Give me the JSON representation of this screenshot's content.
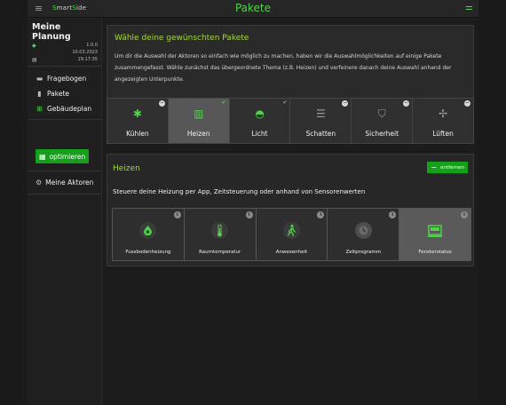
{
  "topbar": {
    "brand_prefix": "S",
    "brand_mid": "mart",
    "brand_s": "S",
    "brand_suffix": "ide",
    "title": "Pakete"
  },
  "plan": {
    "name": "Meine Planung",
    "version": "1.0.0",
    "date": "10.03.2023",
    "time": "19:17:35"
  },
  "nav": {
    "items": [
      {
        "label": "Fragebogen",
        "icon": "questionnaire-icon"
      },
      {
        "label": "Pakete",
        "icon": "package-icon"
      },
      {
        "label": "Gebäudeplan",
        "icon": "floorplan-icon"
      }
    ],
    "optimize_label": "optimieren",
    "actors_label": "Meine Aktoren"
  },
  "intro": {
    "title": "Wähle deine gewünschten Pakete",
    "text": "Um dir die Auswahl der Aktoren so einfach wie möglich zu machen, haben wir die Auswahlmöglichkeiten auf einige Pakete zusammengefasst. Wähle zunächst das übergeordnete Thema (z.B. Heizen) und verfeinere danach deine Auswahl anhand der angezeigten Unterpunkte."
  },
  "categories": [
    {
      "label": "Kühlen",
      "icon": "snowflake-icon",
      "glyph": "✱",
      "state": "minus",
      "active": false
    },
    {
      "label": "Heizen",
      "icon": "radiator-icon",
      "glyph": "▥",
      "state": "check",
      "active": true
    },
    {
      "label": "Licht",
      "icon": "lamp-icon",
      "glyph": "◓",
      "state": "check",
      "active": false
    },
    {
      "label": "Schatten",
      "icon": "blinds-icon",
      "glyph": "☰",
      "state": "minus",
      "active": false
    },
    {
      "label": "Sicherheit",
      "icon": "shield-icon",
      "glyph": "⛉",
      "state": "minus",
      "active": false
    },
    {
      "label": "Lüften",
      "icon": "fan-icon",
      "glyph": "✢",
      "state": "minus",
      "active": false
    }
  ],
  "panel": {
    "title": "Heizen",
    "remove_label": "entfernen",
    "subtitle": "Steuere deine Heizung per App, Zeitsteuerung oder anhand von Sensorenwerten",
    "items": [
      {
        "label": "Fussbodenheizung",
        "icon": "water-drop-icon",
        "glyph": "💧"
      },
      {
        "label": "Raumtemperatur",
        "icon": "thermometer-icon",
        "glyph": "🌡"
      },
      {
        "label": "Anwesenheit",
        "icon": "walking-person-icon",
        "glyph": "🚶"
      },
      {
        "label": "Zeitprogramm",
        "icon": "clock-icon",
        "glyph": "◷"
      },
      {
        "label": "Fensterstatus",
        "icon": "window-icon",
        "glyph": "▣"
      }
    ]
  },
  "colors": {
    "accent": "#4fd24a",
    "title_accent": "#a6d63a",
    "button": "#15a01c"
  }
}
